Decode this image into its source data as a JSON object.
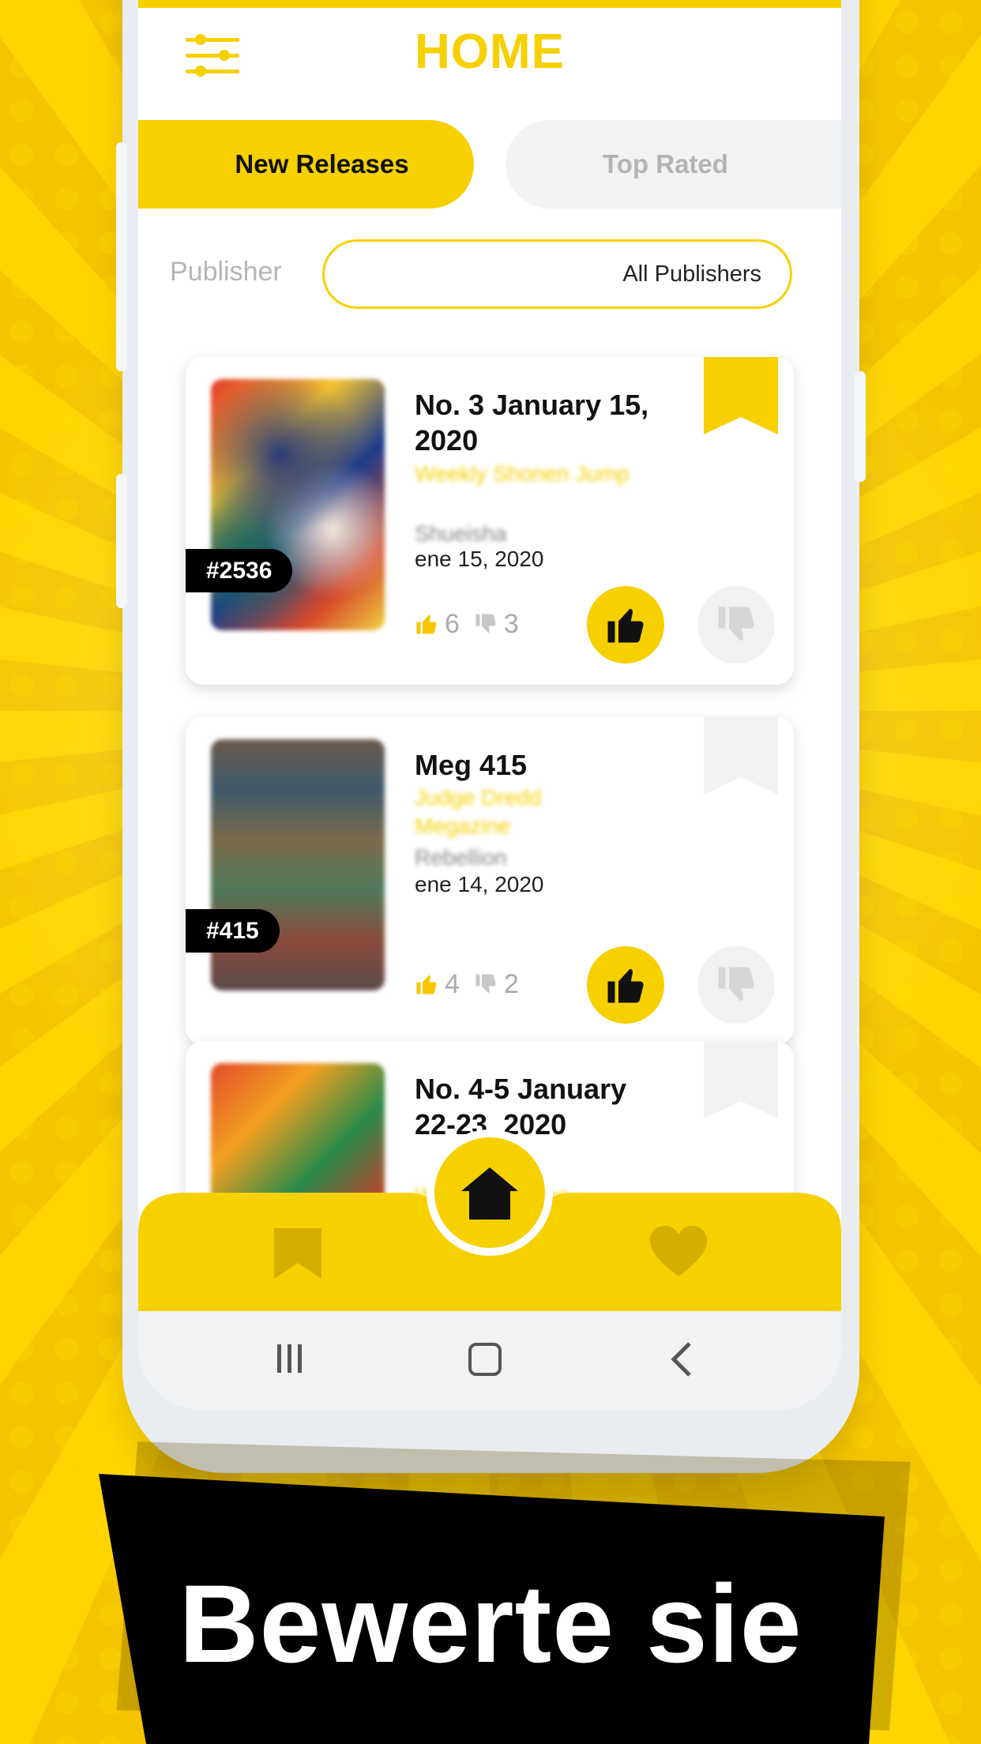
{
  "header": {
    "title": "HOME",
    "menu_icon": "filter-sliders-icon"
  },
  "tabs": [
    {
      "label": "New Releases",
      "active": true
    },
    {
      "label": "Top Rated",
      "active": false
    }
  ],
  "filter": {
    "label": "Publisher",
    "value": "All Publishers"
  },
  "cards": [
    {
      "issue": "#2536",
      "title": "No. 3 January 15, 2020",
      "series": "Weekly Shonen Jump",
      "publisher": "Shueisha",
      "date": "ene 15, 2020",
      "likes": "6",
      "dislikes": "3",
      "bookmarked": true
    },
    {
      "issue": "#415",
      "title": "Meg 415",
      "series": "Judge Dredd Megazine",
      "publisher": "Rebellion",
      "date": "ene 14, 2020",
      "likes": "4",
      "dislikes": "2",
      "bookmarked": false
    },
    {
      "title": "No. 4-5 January 22-23, 2020",
      "series": "Weekly Shonen",
      "bookmarked": false
    }
  ],
  "bottom_nav": {
    "items": [
      "bookmark-icon",
      "home-icon",
      "heart-icon"
    ]
  },
  "colors": {
    "accent": "#f7d000",
    "background": "#f7c600",
    "banner": "#000000"
  },
  "banner": {
    "text": "Bewerte sie"
  }
}
